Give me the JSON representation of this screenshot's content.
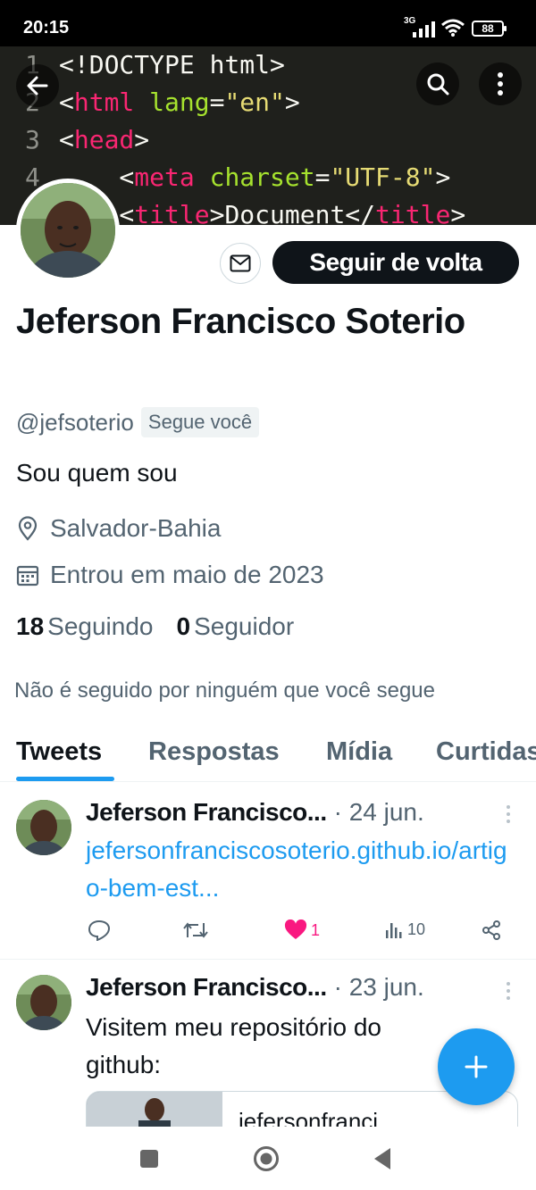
{
  "status_bar": {
    "time": "20:15",
    "network": "3G",
    "battery": "88",
    "icons": [
      "signal-icon",
      "wifi-icon",
      "battery-icon"
    ]
  },
  "banner": {
    "code_lines": [
      {
        "num": "1",
        "parts": [
          {
            "t": "<!DOCTYPE html>",
            "c": "txt"
          }
        ]
      },
      {
        "num": "2",
        "parts": [
          {
            "t": "<",
            "c": "txt"
          },
          {
            "t": "html",
            "c": "tag"
          },
          {
            "t": " lang",
            "c": "attr"
          },
          {
            "t": "=",
            "c": "txt"
          },
          {
            "t": "\"en\"",
            "c": "str"
          },
          {
            "t": ">",
            "c": "txt"
          }
        ]
      },
      {
        "num": "3",
        "parts": [
          {
            "t": "<",
            "c": "txt"
          },
          {
            "t": "head",
            "c": "tag"
          },
          {
            "t": ">",
            "c": "txt"
          }
        ]
      },
      {
        "num": "4",
        "parts": [
          {
            "t": "    <",
            "c": "txt"
          },
          {
            "t": "meta",
            "c": "tag"
          },
          {
            "t": " charset",
            "c": "attr"
          },
          {
            "t": "=",
            "c": "txt"
          },
          {
            "t": "\"UTF-8\"",
            "c": "str"
          },
          {
            "t": ">",
            "c": "txt"
          }
        ]
      },
      {
        "num": "",
        "parts": [
          {
            "t": "    <",
            "c": "txt"
          },
          {
            "t": "title",
            "c": "tag"
          },
          {
            "t": ">Document</",
            "c": "txt"
          },
          {
            "t": "title",
            "c": "tag"
          },
          {
            "t": ">",
            "c": "txt"
          }
        ]
      }
    ]
  },
  "profile": {
    "follow_back_label": "Seguir de volta",
    "name": "Jeferson Francisco Soterio",
    "handle": "@jefsoterio",
    "follows_you": "Segue você",
    "bio": "Sou quem sou",
    "location": "Salvador-Bahia",
    "joined": "Entrou em maio de 2023",
    "following_count": "18",
    "following_label": "Seguindo",
    "followers_count": "0",
    "followers_label": "Seguidor",
    "not_followed_note": "Não é seguido por ninguém que você segue"
  },
  "tabs": [
    {
      "label": "Tweets",
      "active": true
    },
    {
      "label": "Respostas",
      "active": false
    },
    {
      "label": "Mídia",
      "active": false
    },
    {
      "label": "Curtidas",
      "active": false
    }
  ],
  "tweets": [
    {
      "author": "Jeferson Francisco...",
      "date": "· 24 jun.",
      "link_text": "jefersonfranciscosoterio.github.io/artigo-bem-est...",
      "likes": "1",
      "views": "10"
    },
    {
      "author": "Jeferson Francisco...",
      "date": "· 23 jun.",
      "text": "Visitem meu repositório do github:",
      "card_text": "jefersonfranci"
    }
  ],
  "colors": {
    "accent": "#1d9bf0",
    "like": "#f91880",
    "text_secondary": "#536471"
  }
}
